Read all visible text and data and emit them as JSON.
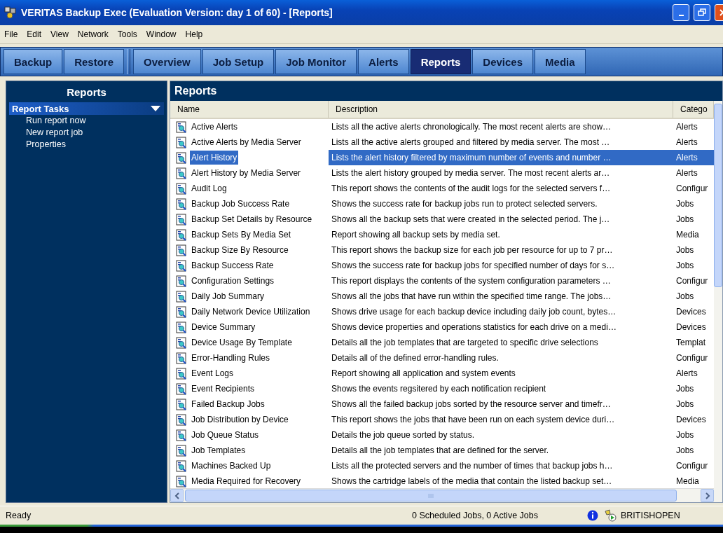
{
  "window": {
    "title": "VERITAS Backup Exec (Evaluation Version: day 1 of 60) - [Reports]"
  },
  "menu": [
    "File",
    "Edit",
    "View",
    "Network",
    "Tools",
    "Window",
    "Help"
  ],
  "tab_groups": [
    [
      {
        "label": "Backup",
        "selected": false
      },
      {
        "label": "Restore",
        "selected": false
      }
    ],
    [
      {
        "label": "Overview",
        "selected": false
      },
      {
        "label": "Job Setup",
        "selected": false
      },
      {
        "label": "Job Monitor",
        "selected": false
      },
      {
        "label": "Alerts",
        "selected": false
      },
      {
        "label": "Reports",
        "selected": true
      },
      {
        "label": "Devices",
        "selected": false
      },
      {
        "label": "Media",
        "selected": false
      }
    ]
  ],
  "sidebar": {
    "title": "Reports",
    "section": {
      "title": "Report Tasks",
      "expanded": true,
      "items": [
        "Run report now",
        "New report job",
        "Properties"
      ]
    }
  },
  "main": {
    "title": "Reports",
    "table": {
      "columns": [
        "Name",
        "Description",
        "Catego"
      ],
      "rows": [
        {
          "name": "Active Alerts",
          "description": "Lists all the active alerts chronologically.  The most recent alerts are show…",
          "category": "Alerts",
          "selected": false
        },
        {
          "name": "Active Alerts by Media Server",
          "description": "Lists all the active alerts grouped  and filtered by media server.  The most …",
          "category": "Alerts",
          "selected": false
        },
        {
          "name": "Alert History",
          "description": "Lists the alert history filtered by maximum number of events and number …",
          "category": "Alerts",
          "selected": true
        },
        {
          "name": "Alert History by Media Server",
          "description": "Lists the alert history grouped by media server.  The most recent alerts ar…",
          "category": "Alerts",
          "selected": false
        },
        {
          "name": "Audit Log",
          "description": "This report shows the contents of the audit logs for the selected servers f…",
          "category": "Configur",
          "selected": false
        },
        {
          "name": "Backup Job Success Rate",
          "description": "Shows the success rate for backup jobs run to protect selected servers.",
          "category": "Jobs",
          "selected": false
        },
        {
          "name": "Backup Set Details by Resource",
          "description": "Shows all the backup sets that were created in the selected period.  The j…",
          "category": "Jobs",
          "selected": false
        },
        {
          "name": "Backup Sets By Media Set",
          "description": "Report showing all backup sets by media set.",
          "category": "Media",
          "selected": false
        },
        {
          "name": "Backup Size By Resource",
          "description": "This report shows the backup size for each job per resource for up to 7 pr…",
          "category": "Jobs",
          "selected": false
        },
        {
          "name": "Backup Success Rate",
          "description": "Shows the success rate for backup jobs for specified number of days for s…",
          "category": "Jobs",
          "selected": false
        },
        {
          "name": "Configuration Settings",
          "description": "This report displays the contents of the system configuration parameters …",
          "category": "Configur",
          "selected": false
        },
        {
          "name": "Daily Job Summary",
          "description": "Shows all the jobs that have run within the specified time range.  The jobs…",
          "category": "Jobs",
          "selected": false
        },
        {
          "name": "Daily Network Device Utilization",
          "description": "Shows drive usage for each backup device including daily job count, bytes…",
          "category": "Devices",
          "selected": false
        },
        {
          "name": "Device Summary",
          "description": "Shows device properties and operations statistics for each drive on a medi…",
          "category": "Devices",
          "selected": false
        },
        {
          "name": "Device Usage By Template",
          "description": "Details all the job templates that are targeted to specific drive selections",
          "category": "Templat",
          "selected": false
        },
        {
          "name": "Error-Handling Rules",
          "description": "Details all of the defined error-handling rules.",
          "category": "Configur",
          "selected": false
        },
        {
          "name": "Event Logs",
          "description": "Report showing all application and system events",
          "category": "Alerts",
          "selected": false
        },
        {
          "name": "Event Recipients",
          "description": "Shows the events regsitered by each notification recipient",
          "category": "Jobs",
          "selected": false
        },
        {
          "name": "Failed Backup Jobs",
          "description": "Shows all the failed backup jobs sorted by the resource server and timefr…",
          "category": "Jobs",
          "selected": false
        },
        {
          "name": "Job Distribution by Device",
          "description": "This report shows the jobs that have been run on each system device duri…",
          "category": "Devices",
          "selected": false
        },
        {
          "name": "Job Queue Status",
          "description": "Details the job queue sorted by status.",
          "category": "Jobs",
          "selected": false
        },
        {
          "name": "Job Templates",
          "description": "Details all the job templates that are defined for the server.",
          "category": "Jobs",
          "selected": false
        },
        {
          "name": "Machines Backed Up",
          "description": "Lists all the protected servers and the number of times that backup jobs h…",
          "category": "Configur",
          "selected": false
        },
        {
          "name": "Media Required for Recovery",
          "description": "Shows the cartridge labels of the media that contain the listed backup set…",
          "category": "Media",
          "selected": false
        }
      ]
    }
  },
  "status_bar": {
    "left": "Ready",
    "jobs": "0 Scheduled Jobs, 0 Active Jobs",
    "server": "BRITISHOPEN"
  }
}
